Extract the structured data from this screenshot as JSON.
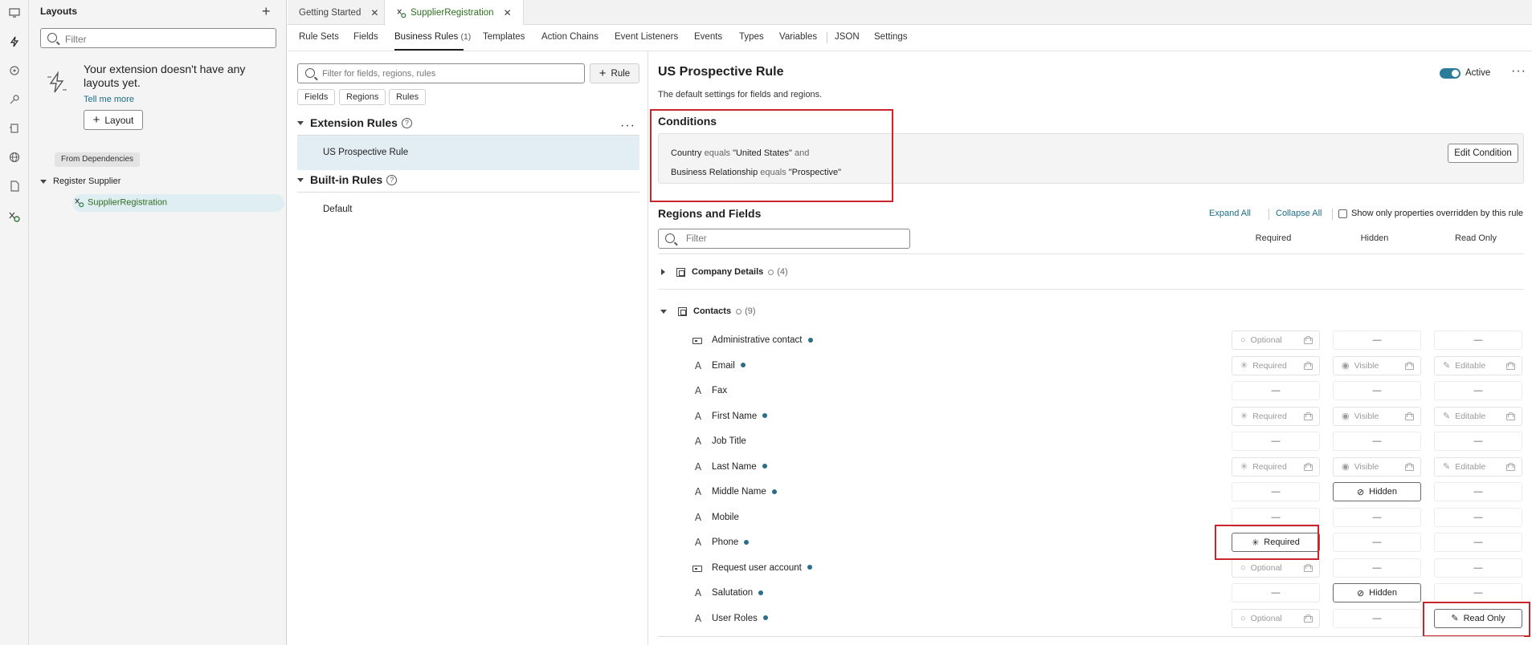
{
  "left_panel": {
    "title": "Layouts",
    "filter_placeholder": "Filter",
    "empty_message": "Your extension doesn't have any layouts yet.",
    "tell_me_more": "Tell me more",
    "layout_button": "Layout",
    "from_dependencies": "From Dependencies",
    "tree": {
      "parent": "Register Supplier",
      "child": "SupplierRegistration"
    }
  },
  "tabs": [
    {
      "label": "Getting Started"
    },
    {
      "label": "SupplierRegistration"
    }
  ],
  "subnav": {
    "items": [
      "Rule Sets",
      "Fields",
      "Business Rules",
      "Templates",
      "Action Chains",
      "Event Listeners",
      "Events",
      "Types",
      "Variables",
      "JSON",
      "Settings"
    ],
    "business_rules_count": "(1)",
    "active": "Business Rules"
  },
  "rule_pane": {
    "filter_placeholder": "Filter for fields, regions, rules",
    "add_rule": "Rule",
    "chips": [
      "Fields",
      "Regions",
      "Rules"
    ],
    "extension_rules_heading": "Extension Rules",
    "extension_rules": [
      "US Prospective Rule"
    ],
    "builtin_rules_heading": "Built-in Rules",
    "builtin_rules": [
      "Default"
    ]
  },
  "detail": {
    "title": "US Prospective Rule",
    "subtitle": "The default settings for fields and regions.",
    "status": "Active",
    "status_on": true,
    "conditions_heading": "Conditions",
    "conditions": [
      {
        "field": "Country",
        "op": "equals",
        "value": "\"United States\"",
        "join": "and"
      },
      {
        "field": "Business Relationship",
        "op": "equals",
        "value": "\"Prospective\"",
        "join": ""
      }
    ],
    "edit_condition": "Edit Condition",
    "regions_heading": "Regions and Fields",
    "expand_all": "Expand All",
    "collapse_all": "Collapse All",
    "show_only_label": "Show only properties overridden by this rule",
    "filter_placeholder": "Filter",
    "columns": {
      "required": "Required",
      "hidden": "Hidden",
      "read_only": "Read Only"
    },
    "groups": [
      {
        "name": "Company Details",
        "count": "(4)",
        "expanded": false
      },
      {
        "name": "Contacts",
        "count": "(9)",
        "expanded": true
      }
    ],
    "fields": [
      {
        "name": "Administrative contact",
        "icon": "checkbox-field-icon",
        "dot": true,
        "required": "Optional",
        "required_state": "optional-locked",
        "hidden": "—",
        "hidden_state": "empty",
        "readonly": "—",
        "readonly_state": "empty"
      },
      {
        "name": "Email",
        "icon": "text-field-icon",
        "dot": true,
        "required": "Required",
        "required_state": "required-locked",
        "hidden": "Visible",
        "hidden_state": "visible-locked",
        "readonly": "Editable",
        "readonly_state": "editable-locked"
      },
      {
        "name": "Fax",
        "icon": "text-field-icon",
        "dot": false,
        "required": "—",
        "required_state": "empty",
        "hidden": "—",
        "hidden_state": "empty",
        "readonly": "—",
        "readonly_state": "empty"
      },
      {
        "name": "First Name",
        "icon": "text-field-icon",
        "dot": true,
        "required": "Required",
        "required_state": "required-locked",
        "hidden": "Visible",
        "hidden_state": "visible-locked",
        "readonly": "Editable",
        "readonly_state": "editable-locked"
      },
      {
        "name": "Job Title",
        "icon": "text-field-icon",
        "dot": false,
        "required": "—",
        "required_state": "empty",
        "hidden": "—",
        "hidden_state": "empty",
        "readonly": "—",
        "readonly_state": "empty"
      },
      {
        "name": "Last Name",
        "icon": "text-field-icon",
        "dot": true,
        "required": "Required",
        "required_state": "required-locked",
        "hidden": "Visible",
        "hidden_state": "visible-locked",
        "readonly": "Editable",
        "readonly_state": "editable-locked"
      },
      {
        "name": "Middle Name",
        "icon": "text-field-icon",
        "dot": true,
        "required": "—",
        "required_state": "empty",
        "hidden": "Hidden",
        "hidden_state": "hidden-on",
        "readonly": "—",
        "readonly_state": "empty"
      },
      {
        "name": "Mobile",
        "icon": "text-field-icon",
        "dot": false,
        "required": "—",
        "required_state": "empty",
        "hidden": "—",
        "hidden_state": "empty",
        "readonly": "—",
        "readonly_state": "empty"
      },
      {
        "name": "Phone",
        "icon": "text-field-icon",
        "dot": true,
        "required": "Required",
        "required_state": "required-on",
        "hidden": "—",
        "hidden_state": "empty",
        "readonly": "—",
        "readonly_state": "empty"
      },
      {
        "name": "Request user account",
        "icon": "checkbox-field-icon",
        "dot": true,
        "required": "Optional",
        "required_state": "optional-locked",
        "hidden": "—",
        "hidden_state": "empty",
        "readonly": "—",
        "readonly_state": "empty"
      },
      {
        "name": "Salutation",
        "icon": "text-field-icon",
        "dot": true,
        "required": "—",
        "required_state": "empty",
        "hidden": "Hidden",
        "hidden_state": "hidden-on",
        "readonly": "—",
        "readonly_state": "empty"
      },
      {
        "name": "User Roles",
        "icon": "text-field-icon",
        "dot": true,
        "required": "Optional",
        "required_state": "optional-locked",
        "hidden": "—",
        "hidden_state": "empty",
        "readonly": "Read Only",
        "readonly_state": "readonly-on"
      }
    ]
  },
  "colors": {
    "accent": "#2b7b9a",
    "highlight": "#c9252c",
    "selection": "#e2eef3",
    "tab_active_text": "#2f6e1f"
  }
}
